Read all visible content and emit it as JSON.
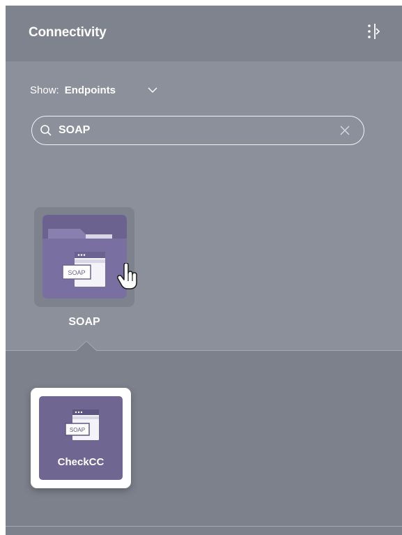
{
  "panel": {
    "title": "Connectivity",
    "collapse_icon": "collapse-panel-icon"
  },
  "filter": {
    "label": "Show:",
    "value": "Endpoints"
  },
  "search": {
    "value": "SOAP",
    "placeholder": ""
  },
  "results": [
    {
      "label": "SOAP",
      "icon": "folder-soap-icon",
      "badge_text": "SOAP"
    }
  ],
  "endpoints": [
    {
      "label": "CheckCC",
      "icon": "soap-endpoint-icon",
      "badge_text": "SOAP"
    }
  ],
  "colors": {
    "panel_bg": "#8b909b",
    "header_bg": "#7f838e",
    "tile_bg": "#7e828c",
    "folder_purple": "#7a6fa1",
    "endpoint_purple": "#6f6691"
  }
}
